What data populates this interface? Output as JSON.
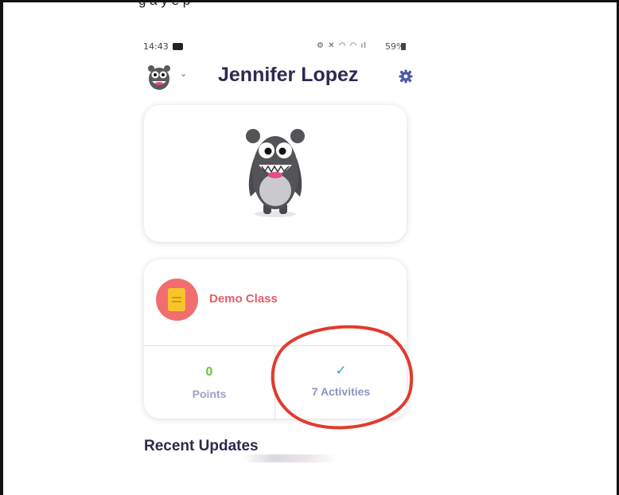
{
  "caption": "g      a          y      e       p",
  "status_bar": {
    "time": "14:43",
    "battery": "59%"
  },
  "header": {
    "user_name": "Jennifer Lopez",
    "avatar_icon": "monster-avatar-icon",
    "settings_icon": "gear-icon"
  },
  "class_card": {
    "class_name": "Demo Class",
    "points_value": "0",
    "points_label": "Points",
    "activities_label": "7 Activities",
    "activities_icon": "checkmark-icon"
  },
  "recent": {
    "title": "Recent Updates"
  },
  "colors": {
    "brand_dark": "#2c2a50",
    "class_red": "#e35d6a",
    "points_green": "#6cc23a",
    "check_blue": "#28a8d8",
    "annotation_red": "#e23a2e"
  }
}
